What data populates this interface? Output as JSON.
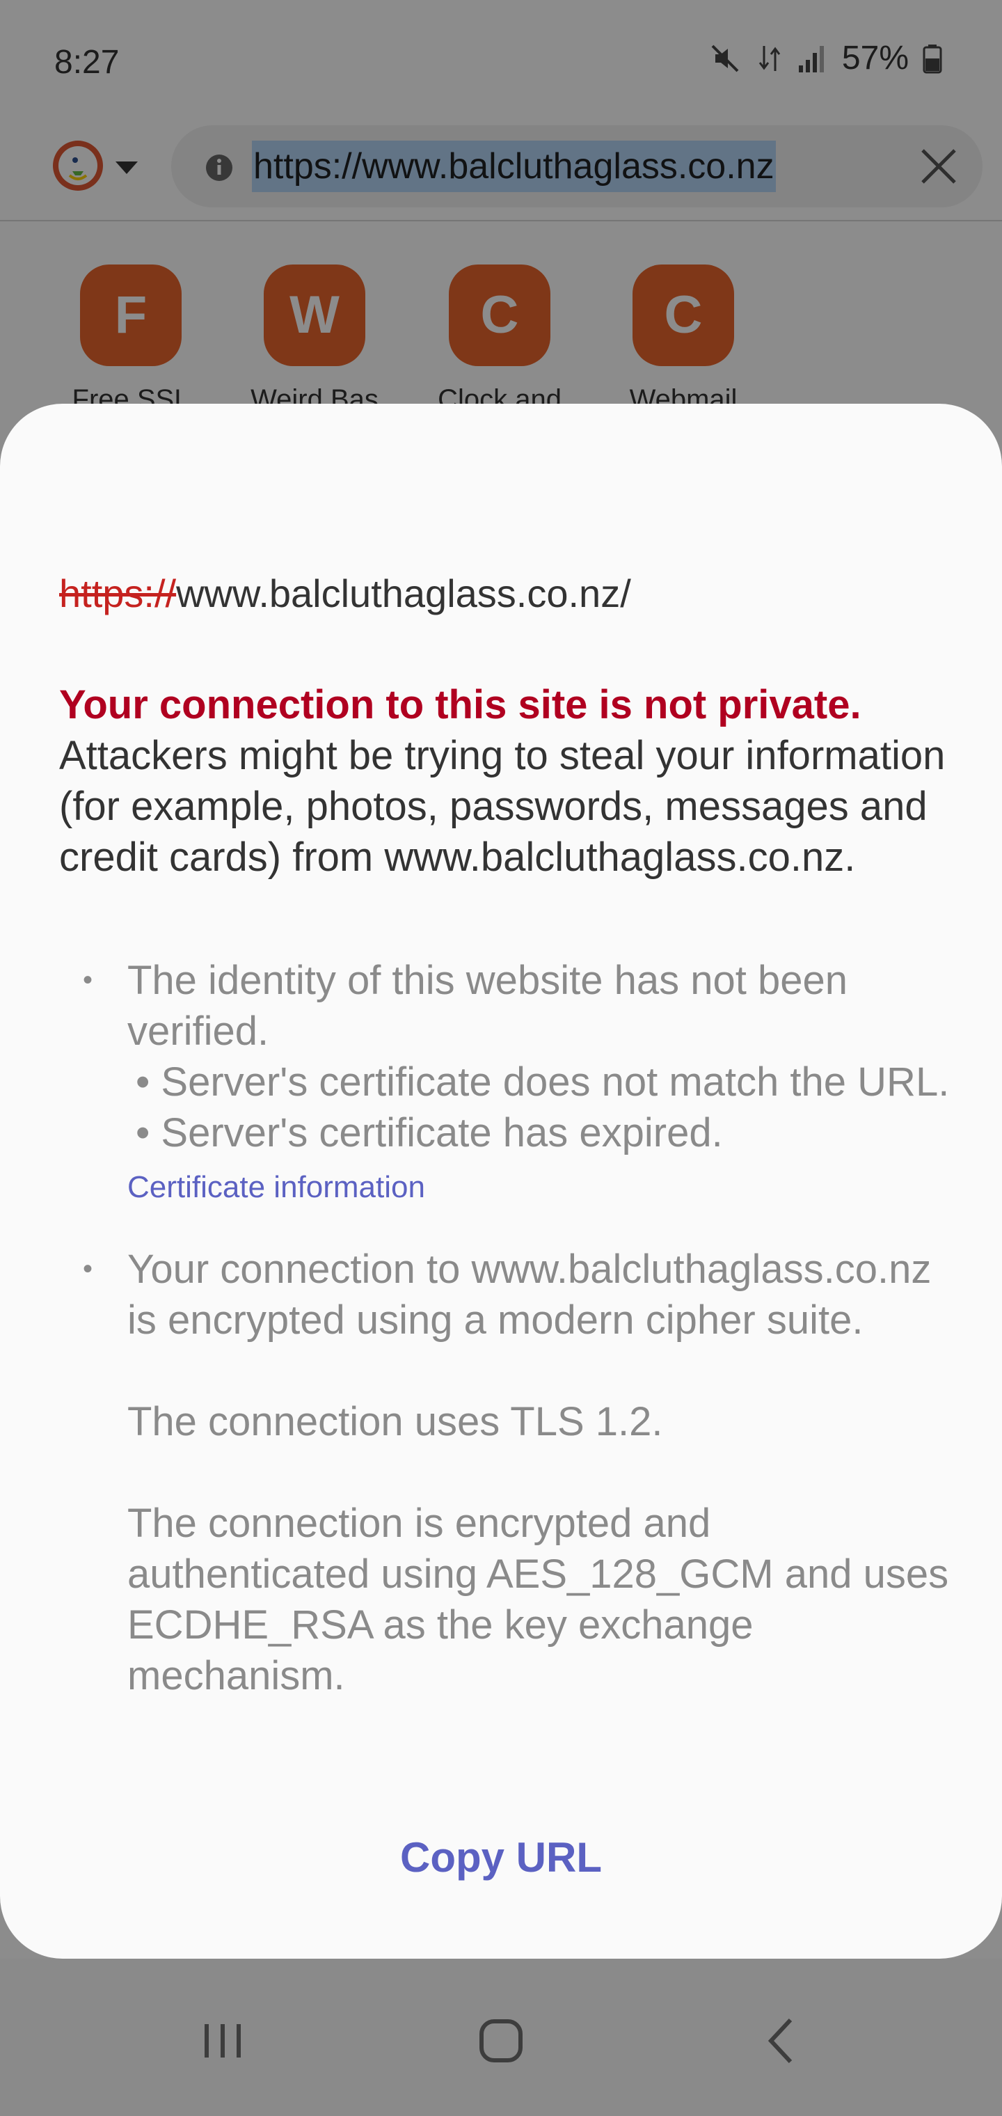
{
  "status_bar": {
    "time": "8:27",
    "battery_percent": "57%",
    "icons": [
      "mute-icon",
      "data-arrows-icon",
      "signal-icon",
      "battery-icon"
    ]
  },
  "browser": {
    "logo_icon": "duckduckgo-logo",
    "url": "https://www.balcluthaglass.co.nz"
  },
  "speed_dial": [
    {
      "letter": "F",
      "label": "Free SSL"
    },
    {
      "letter": "W",
      "label": "Weird Bas"
    },
    {
      "letter": "C",
      "label": "Clock and"
    },
    {
      "letter": "C",
      "label": "Webmail"
    }
  ],
  "sheet": {
    "url_scheme": "https://",
    "url_rest": "www.balcluthaglass.co.nz/",
    "warning_title": "Your connection to this site is not private.",
    "warning_body": " Attackers might be trying to steal your information (for example, photos, passwords, messages and credit cards) from www.balcluthaglass.co.nz.",
    "identity": {
      "main": "The identity of this website has not been verified.",
      "reason1": "• Server's certificate does not match the URL.",
      "reason2": "• Server's certificate has expired.",
      "link": "Certificate information"
    },
    "connection": {
      "p1": "Your connection to www.balcluthaglass.co.nz is encrypted using a modern cipher suite.",
      "p2": "The connection uses TLS 1.2.",
      "p3": "The connection is encrypted and authenticated using AES_128_GCM and uses ECDHE_RSA as the key exchange mechanism."
    },
    "bullet": "•",
    "copy_url": "Copy URL"
  },
  "colors": {
    "warning_red": "#b00020",
    "link_blue": "#5b61c2",
    "tile_orange": "#e8652c"
  }
}
